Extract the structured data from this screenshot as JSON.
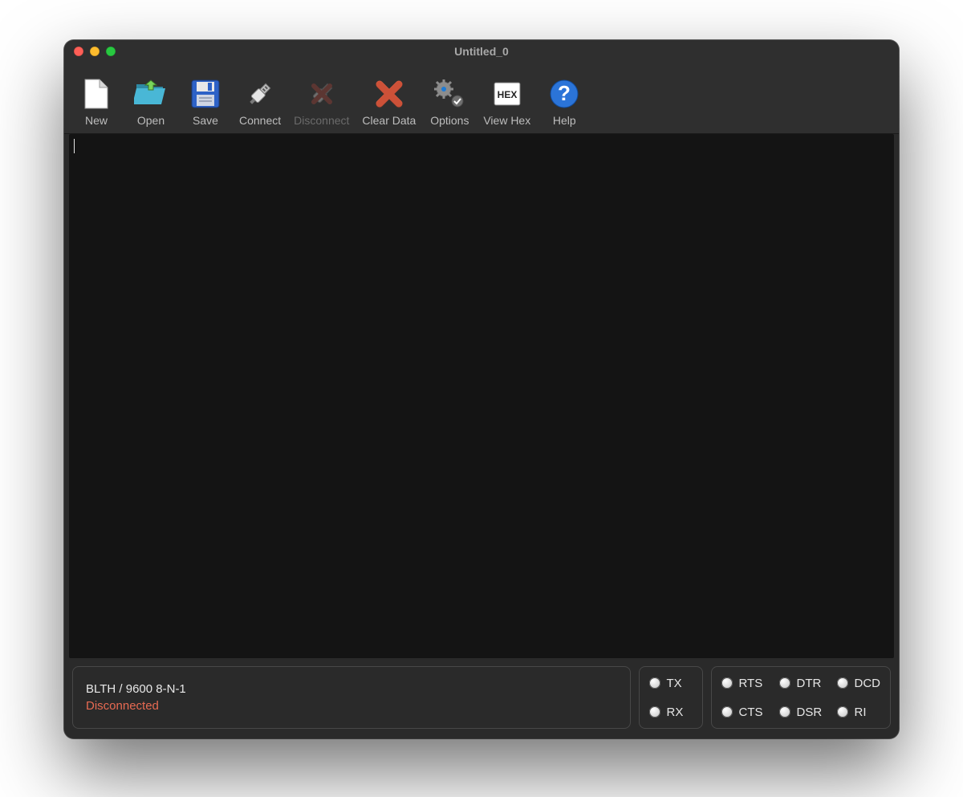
{
  "window": {
    "title": "Untitled_0"
  },
  "toolbar": {
    "new": "New",
    "open": "Open",
    "save": "Save",
    "connect": "Connect",
    "disconnect": "Disconnect",
    "clear": "Clear Data",
    "options": "Options",
    "viewhex": "View Hex",
    "help": "Help"
  },
  "terminal": {
    "content": ""
  },
  "status": {
    "port_line": "BLTH / 9600 8-N-1",
    "state": "Disconnected",
    "state_color": "#e86a52"
  },
  "signals": {
    "tx": "TX",
    "rx": "RX",
    "rts": "RTS",
    "cts": "CTS",
    "dtr": "DTR",
    "dsr": "DSR",
    "dcd": "DCD",
    "ri": "RI"
  }
}
